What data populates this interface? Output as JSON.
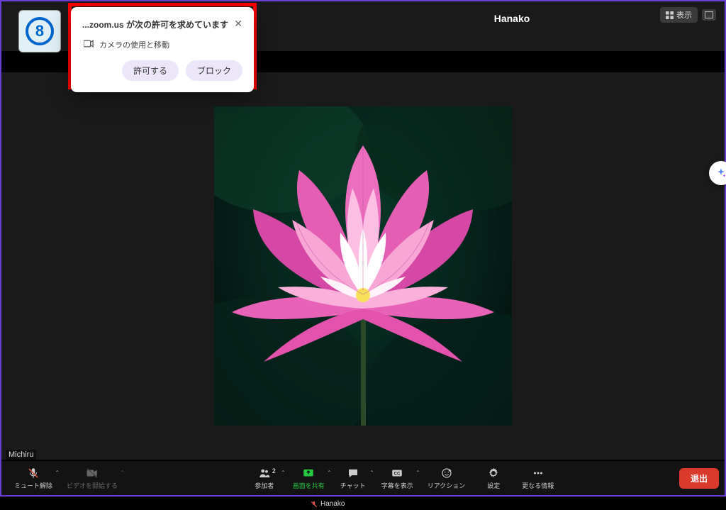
{
  "badge": {
    "number": "8"
  },
  "top": {
    "participant_main": "Hanako",
    "participant_tag": "Hanako",
    "view_label": "表示"
  },
  "permission": {
    "title": "...zoom.us が次の許可を求めています",
    "body": "カメラの使用と移動",
    "allow": "許可する",
    "block": "ブロック"
  },
  "self_name": "Michiru",
  "toolbar": {
    "mute": "ミュート解除",
    "video": "ビデオを開始する",
    "participants": "参加者",
    "participants_count": "2",
    "share": "画面を共有",
    "chat": "チャット",
    "caption": "字幕を表示",
    "reaction": "リアクション",
    "settings": "設定",
    "more": "更なる情報",
    "leave": "退出"
  }
}
